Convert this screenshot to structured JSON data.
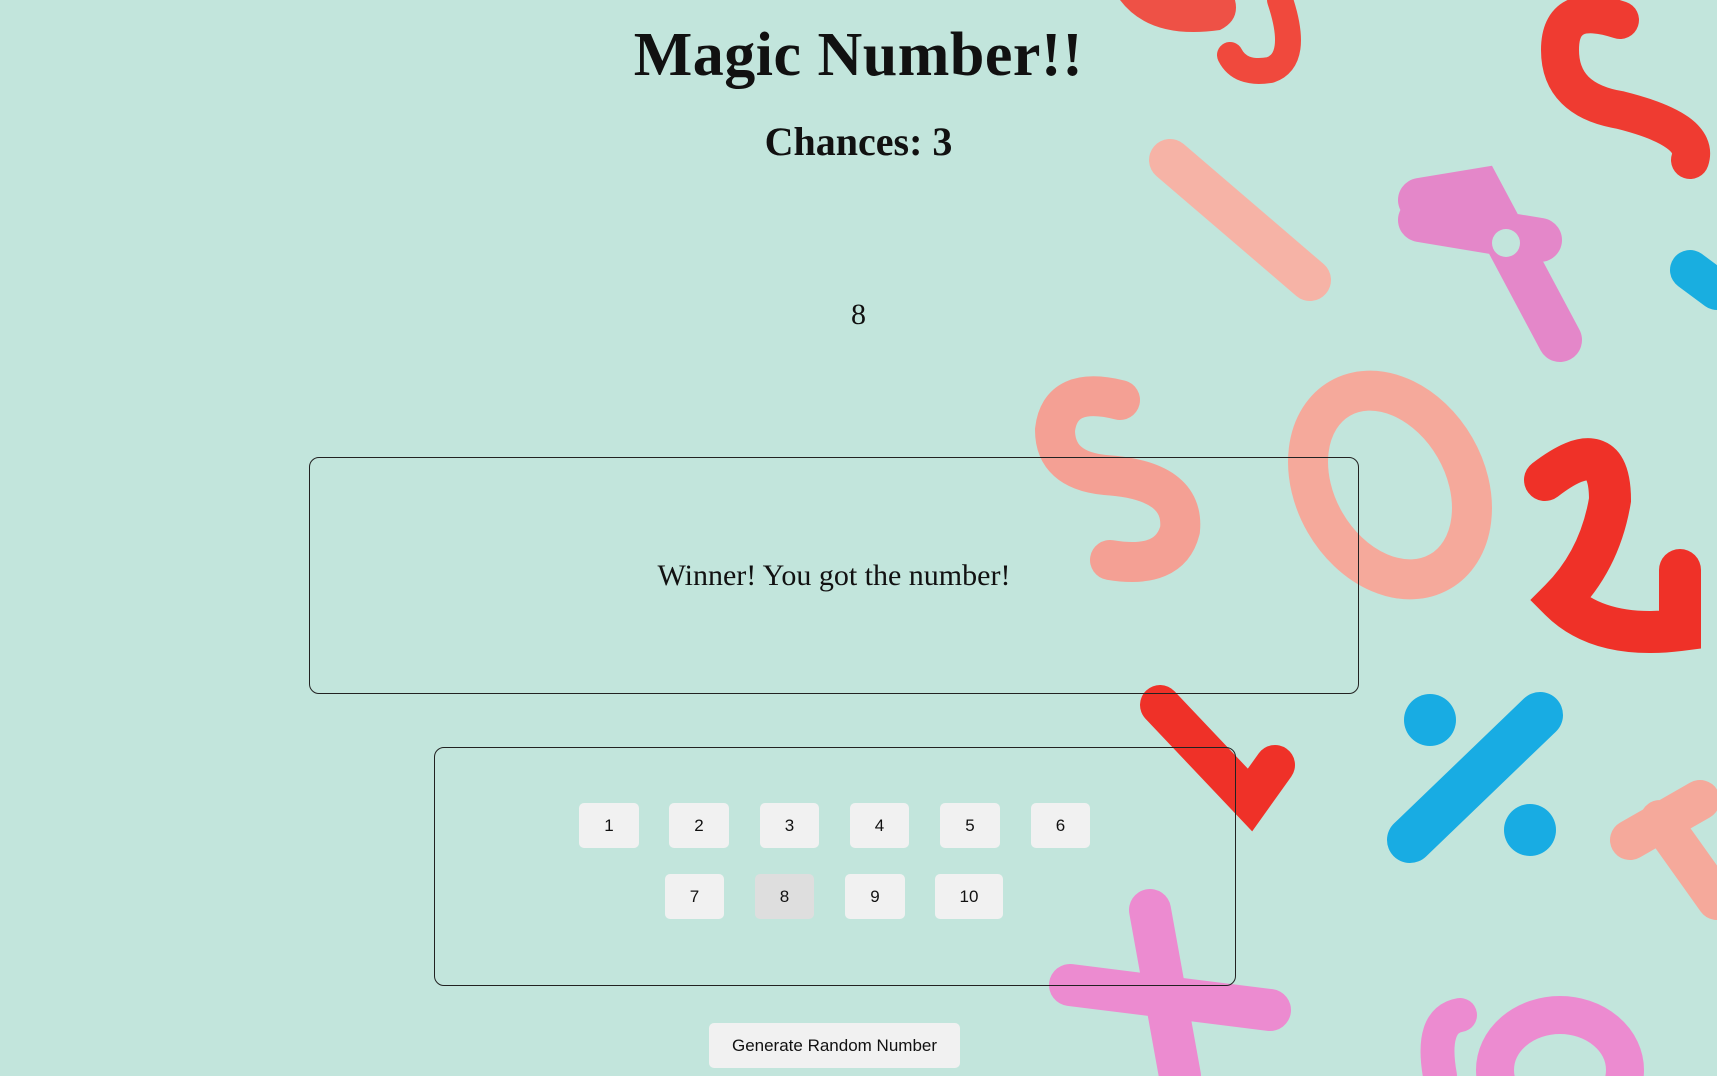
{
  "title": "Magic Number!!",
  "chances_label": "Chances: 3",
  "random_number": "8",
  "result_message": "Winner! You got the number!",
  "number_buttons": [
    {
      "label": "1"
    },
    {
      "label": "2"
    },
    {
      "label": "3"
    },
    {
      "label": "4"
    },
    {
      "label": "5"
    },
    {
      "label": "6"
    },
    {
      "label": "7"
    },
    {
      "label": "8",
      "pressed": true
    },
    {
      "label": "9"
    },
    {
      "label": "10"
    }
  ],
  "generate_button_label": "Generate Random Number",
  "colors": {
    "background": "#c2e5dc",
    "button": "#f1f1f1",
    "button_pressed": "#dedede"
  }
}
